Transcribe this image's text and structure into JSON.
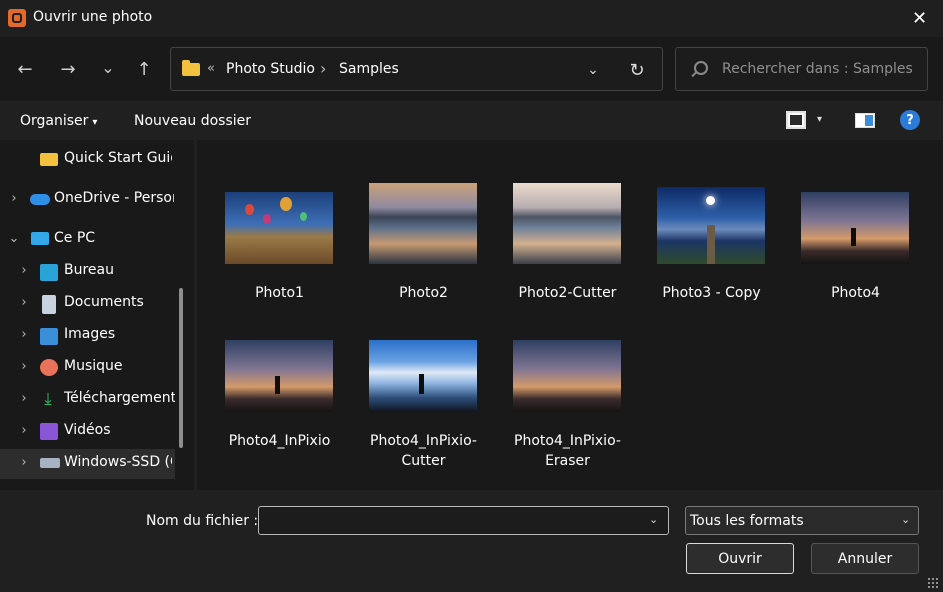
{
  "window": {
    "title": "Ouvrir une photo",
    "close_glyph": "✕",
    "app_icon": "photo-studio-icon"
  },
  "nav": {
    "back_glyph": "←",
    "forward_glyph": "→",
    "recent_glyph": "⌄",
    "up_glyph": "↑",
    "breadcrumb_prefix": "«",
    "breadcrumbs": [
      "Photo Studio",
      "Samples"
    ],
    "breadcrumb_sep": "›",
    "dropdown_glyph": "⌄",
    "refresh_glyph": "↻"
  },
  "search": {
    "placeholder": "Rechercher dans : Samples",
    "value": ""
  },
  "toolbar": {
    "organize_label": "Organiser",
    "new_folder_label": "Nouveau dossier",
    "caret_glyph": "▾",
    "help_glyph": "?"
  },
  "sidebar": {
    "items": [
      {
        "label": "Quick Start Guide",
        "icon": "folder-icon",
        "color": "#f3c13d"
      },
      {
        "label": "OneDrive - Personal",
        "icon": "cloud-icon",
        "color": "#2f8fe6"
      },
      {
        "label": "Ce PC",
        "icon": "computer-icon",
        "color": "#33a8e8"
      },
      {
        "label": "Bureau",
        "icon": "desktop-icon",
        "color": "#2aa3d6"
      },
      {
        "label": "Documents",
        "icon": "document-icon",
        "color": "#c9d3e0"
      },
      {
        "label": "Images",
        "icon": "image-icon",
        "color": "#3b8fd9"
      },
      {
        "label": "Musique",
        "icon": "music-icon",
        "color": "#e8735a"
      },
      {
        "label": "Téléchargements",
        "icon": "download-icon",
        "color": "#34b36a"
      },
      {
        "label": "Vidéos",
        "icon": "video-icon",
        "color": "#8a56d8"
      },
      {
        "label": "Windows-SSD (C:)",
        "icon": "drive-icon",
        "color": "#a7b3c2"
      }
    ],
    "chevron_right": "›",
    "chevron_down": "⌄"
  },
  "files": [
    {
      "name": "Photo1",
      "theme": "balloons"
    },
    {
      "name": "Photo2",
      "theme": "lake"
    },
    {
      "name": "Photo2-Cutter",
      "theme": "lake-faded"
    },
    {
      "name": "Photo3 - Copy",
      "theme": "night-pier"
    },
    {
      "name": "Photo4",
      "theme": "dusk-photographer"
    },
    {
      "name": "Photo4_InPixio",
      "theme": "dusk-photographer"
    },
    {
      "name": "Photo4_InPixio-Cutter",
      "theme": "blue-sky-photographer"
    },
    {
      "name": "Photo4_InPixio-Eraser",
      "theme": "dusk-photographer"
    }
  ],
  "footer": {
    "filename_label": "Nom du fichier :",
    "filename_value": "",
    "filter_label": "Tous les formats",
    "open_label": "Ouvrir",
    "cancel_label": "Annuler",
    "caret_glyph": "⌄"
  }
}
